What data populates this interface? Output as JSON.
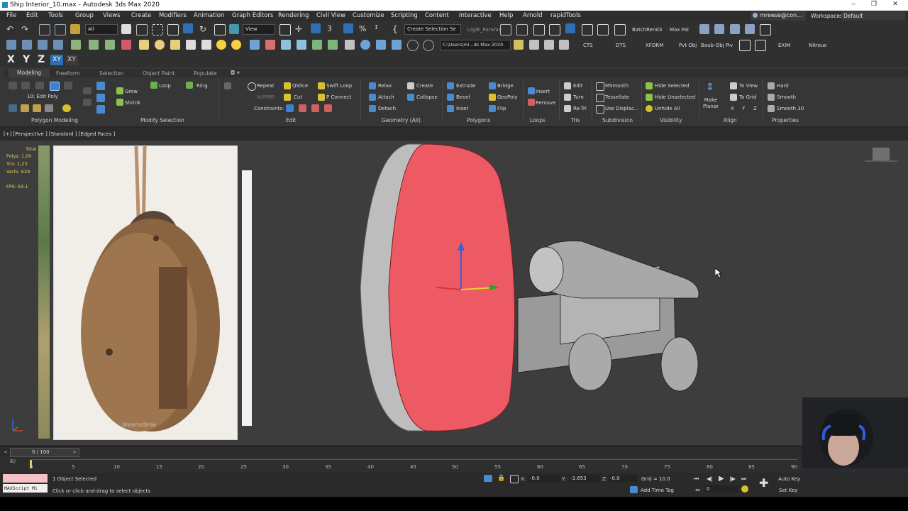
{
  "app": {
    "title": "Ship Interior_10.max - Autodesk 3ds Max 2020"
  },
  "window_controls": {
    "minimize": "‒",
    "restore": "❐",
    "close": "✕"
  },
  "menu": [
    "File",
    "Edit",
    "Tools",
    "Group",
    "Views",
    "Create",
    "Modifiers",
    "Animation",
    "Graph Editors",
    "Rendering",
    "Civil View",
    "Customize",
    "Scripting",
    "Content",
    "Interactive",
    "Help",
    "Arnold",
    "rapidTools"
  ],
  "account": {
    "user": "mreese@con...",
    "workspace_label": "Workspaces:",
    "workspace_value": "Default"
  },
  "toolbar": {
    "selection_filter": "All",
    "ref_coord": "View",
    "named_selection": "Create Selection Se",
    "logik": "LogiK_Params",
    "project_path": "C:\\Users\\mi...ds Max 2020",
    "quick_items": [
      "BatchRend3",
      "Max Pal",
      "CTS",
      "DTS",
      "XFORM",
      "Pvt Obj",
      "Baub-Obj Piv",
      "EXIM",
      "Nitrous"
    ],
    "axis": [
      "X",
      "Y",
      "Z",
      "XY",
      "XY"
    ]
  },
  "ribbon": {
    "tabs": [
      "Modeling",
      "Freeform",
      "Selection",
      "Object Paint",
      "Populate"
    ],
    "panel_titles": [
      "Polygon Modeling",
      "Modify Selection",
      "Edit",
      "Geometry (All)",
      "Polygons",
      "Loops",
      "Tris",
      "Subdivision",
      "Visibility",
      "Align",
      "Properties"
    ],
    "edit_poly_label": "10: Edit Poly",
    "modify_selection": [
      "Grow",
      "Shrink",
      "Loop",
      "Ring"
    ],
    "edit": [
      "Repeat",
      "QSlice",
      "Swift Loop",
      "NURMS",
      "Cut",
      "P Connect",
      "Constraints:"
    ],
    "geometry": [
      "Relax",
      "Create",
      "Attach",
      "Collapse",
      "Detach"
    ],
    "polygons": [
      "Extrude",
      "Bridge",
      "Bevel",
      "GeoPoly",
      "Inset",
      "Flip"
    ],
    "loops": [
      "Insert",
      "Remove"
    ],
    "tris": [
      "Edit",
      "Turn",
      "Re-Tri"
    ],
    "subdivision": [
      "MSmooth",
      "Tessellate",
      "Use Displac..."
    ],
    "visibility": [
      "Hide Selected",
      "Hide Unselected",
      "Unhide All"
    ],
    "align": [
      "Make Planar",
      "To View",
      "To Grid",
      "X",
      "Y",
      "Z"
    ],
    "properties": [
      "Hard",
      "Smooth",
      "Smooth 30"
    ]
  },
  "viewport": {
    "label": "[+] [Perspective ] [Standard ] [Edged Faces ]",
    "stats": {
      "header": "Total",
      "polys": "Polys: 1,00",
      "tris": "Tris: 1,23",
      "verts": "Verts: 629",
      "fps": "FPS: 64.1"
    }
  },
  "reference_image": {
    "watermark": "dreamstime"
  },
  "timeline": {
    "frame_display": "0 / 100",
    "ticks": [
      "0",
      "5",
      "10",
      "15",
      "20",
      "25",
      "30",
      "35",
      "40",
      "45",
      "50",
      "55",
      "60",
      "65",
      "70",
      "75",
      "80",
      "85",
      "90"
    ]
  },
  "status": {
    "maxscript": "MAXScript Mi",
    "selected": "1 Object Selected",
    "prompt": "Click or click-and-drag to select objects",
    "x": "-0.0",
    "y": "-3.653",
    "z": "-0.0",
    "grid": "Grid = 10.0",
    "add_time_tag": "Add Time Tag",
    "auto_key": "Auto Key",
    "set_key": "Set Key",
    "frame": "0"
  }
}
